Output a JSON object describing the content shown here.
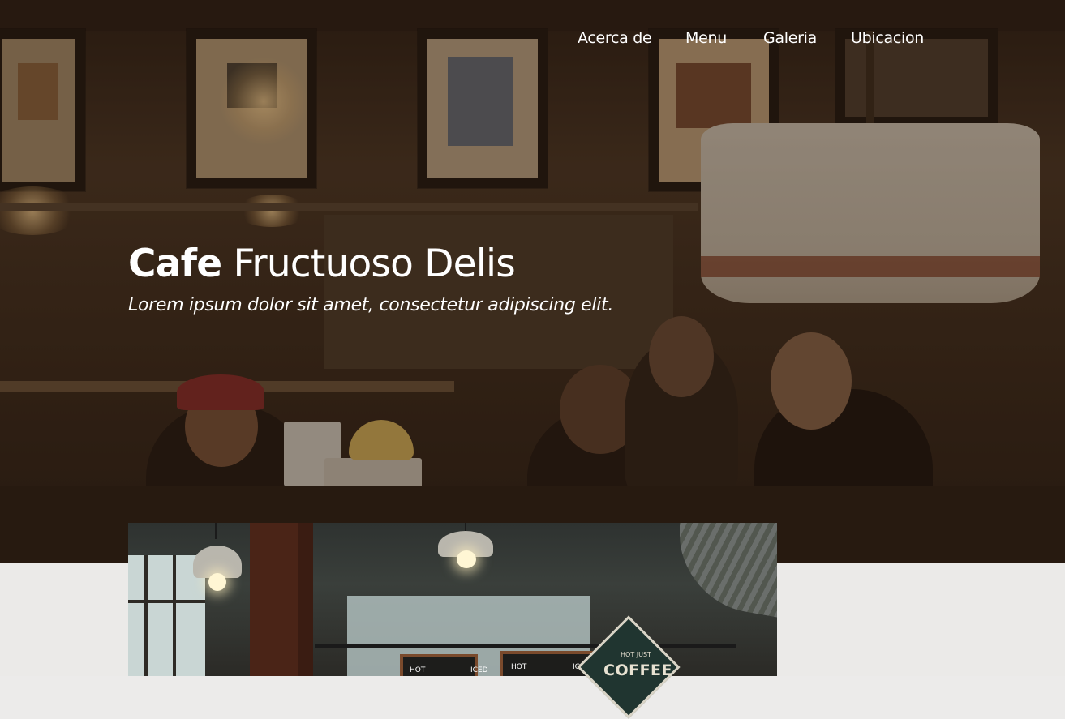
{
  "nav": {
    "items": [
      {
        "label": "Acerca de"
      },
      {
        "label": "Menu"
      },
      {
        "label": "Galeria"
      },
      {
        "label": "Ubicacion"
      }
    ]
  },
  "hero": {
    "title_bold": "Cafe",
    "title_rest": " Fructuoso Delis",
    "tagline": "Lorem ipsum dolor sit amet, consectetur adipiscing elit."
  },
  "photo": {
    "sign_top": "HOT  JUST",
    "sign_text": "COFFEE",
    "board_left": "HOT",
    "board_left_right": "ICED",
    "board_right": "HOT",
    "board_right_right": "ICED"
  },
  "colors": {
    "hero_overlay": "#23160c",
    "nav_text": "#ffffff",
    "content_bg": "#ebeae8"
  }
}
